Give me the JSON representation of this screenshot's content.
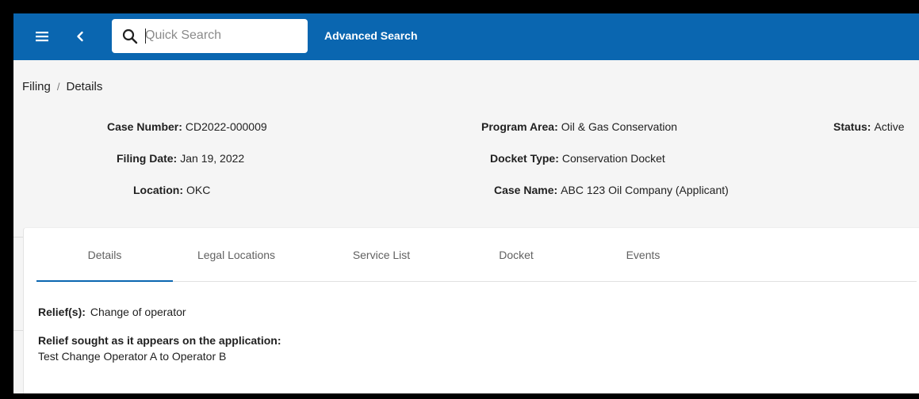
{
  "appbar": {
    "search_placeholder": "Quick Search",
    "advanced_search_label": "Advanced Search",
    "menu_icon": "hamburger-menu-icon",
    "back_icon": "chevron-left-icon",
    "search_icon": "magnifier-icon",
    "color": "#0a66b0"
  },
  "breadcrumb": {
    "items": [
      "Filing",
      "Details"
    ],
    "separator": "/"
  },
  "case": {
    "case_number": {
      "label": "Case Number:",
      "value": "CD2022-000009"
    },
    "filing_date": {
      "label": "Filing Date:",
      "value": "Jan 19, 2022"
    },
    "location": {
      "label": "Location:",
      "value": "OKC"
    },
    "program_area": {
      "label": "Program Area:",
      "value": "Oil & Gas Conservation"
    },
    "docket_type": {
      "label": "Docket Type:",
      "value": "Conservation Docket"
    },
    "case_name": {
      "label": "Case Name:",
      "value": "ABC 123 Oil Company (Applicant)"
    },
    "status": {
      "label": "Status:",
      "value": "Active"
    }
  },
  "tabs": [
    {
      "label": "Details",
      "active": true
    },
    {
      "label": "Legal Locations",
      "active": false
    },
    {
      "label": "Service List",
      "active": false
    },
    {
      "label": "Docket",
      "active": false
    },
    {
      "label": "Events",
      "active": false
    }
  ],
  "details": {
    "relief_label": "Relief(s):",
    "relief_value": "Change of operator",
    "relief_sought_label": "Relief sought as it appears on the application:",
    "relief_sought_value": "Test Change Operator A to Operator B"
  }
}
